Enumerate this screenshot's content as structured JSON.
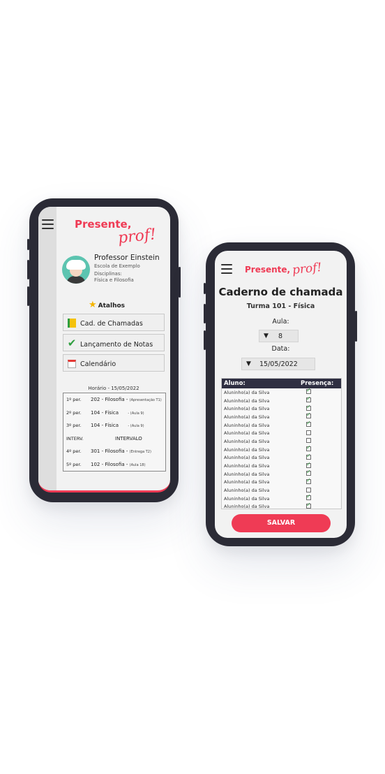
{
  "phone1": {
    "logo_line1": "Presente,",
    "logo_line2": "prof!",
    "professor_name": "Professor Einstein",
    "school": "Escola de Exemplo",
    "disciplines_label": "Disciplinas:",
    "disciplines": "Física e Filosofia",
    "shortcuts_title": "Atalhos",
    "shortcuts": [
      {
        "label": "Cad. de Chamadas",
        "icon": "notebook-icon"
      },
      {
        "label": "Lançamento de Notas",
        "icon": "checkmark-icon"
      },
      {
        "label": "Calendário",
        "icon": "calendar-icon"
      }
    ],
    "schedule_title": "Horário - 15/05/2022",
    "schedule": [
      {
        "period": "1º per.",
        "desc": "202 - Filosofia -",
        "sub": "(Apresentação T1)"
      },
      {
        "period": "2º per.",
        "desc": "104 - Física",
        "sub": "- (Aula 9)"
      },
      {
        "period": "3º per.",
        "desc": "104 - Física",
        "sub": "- (Aula 9)"
      },
      {
        "period": "INTERV.",
        "desc": "INTERVALO",
        "sub": ""
      },
      {
        "period": "4º per.",
        "desc": "301 - Filosofia -",
        "sub": "(Entrega T2)"
      },
      {
        "period": "5º per.",
        "desc": "102 - Filosofia -",
        "sub": "(Aula 18)"
      }
    ]
  },
  "phone2": {
    "logo_line1": "Presente,",
    "logo_line2": "prof!",
    "title": "Caderno de chamada",
    "class": "Turma 101 - Física",
    "aula_label": "Aula:",
    "aula_value": "8",
    "date_label": "Data:",
    "date_value": "15/05/2022",
    "col_student": "Aluno:",
    "col_presence": "Presença:",
    "students": [
      {
        "name": "Aluninho(a) da Silva",
        "present": true
      },
      {
        "name": "Aluninho(a) da Silva",
        "present": true
      },
      {
        "name": "Aluninho(a) da Silva",
        "present": true
      },
      {
        "name": "Aluninho(a) da Silva",
        "present": true
      },
      {
        "name": "Aluninho(a) da Silva",
        "present": true
      },
      {
        "name": "Aluninho(a) da Silva",
        "present": false
      },
      {
        "name": "Aluninho(a) da Silva",
        "present": false
      },
      {
        "name": "Aluninho(a) da Silva",
        "present": true
      },
      {
        "name": "Aluninho(a) da Silva",
        "present": true
      },
      {
        "name": "Aluninho(a) da Silva",
        "present": true
      },
      {
        "name": "Aluninho(a) da Silva",
        "present": true
      },
      {
        "name": "Aluninho(a) da Silva",
        "present": true
      },
      {
        "name": "Aluninho(a) da Silva",
        "present": false
      },
      {
        "name": "Aluninho(a) da Silva",
        "present": true
      },
      {
        "name": "Aluninho(a) da Silva",
        "present": true
      }
    ],
    "save_label": "SALVAR",
    "accent": "#ef3b55"
  }
}
